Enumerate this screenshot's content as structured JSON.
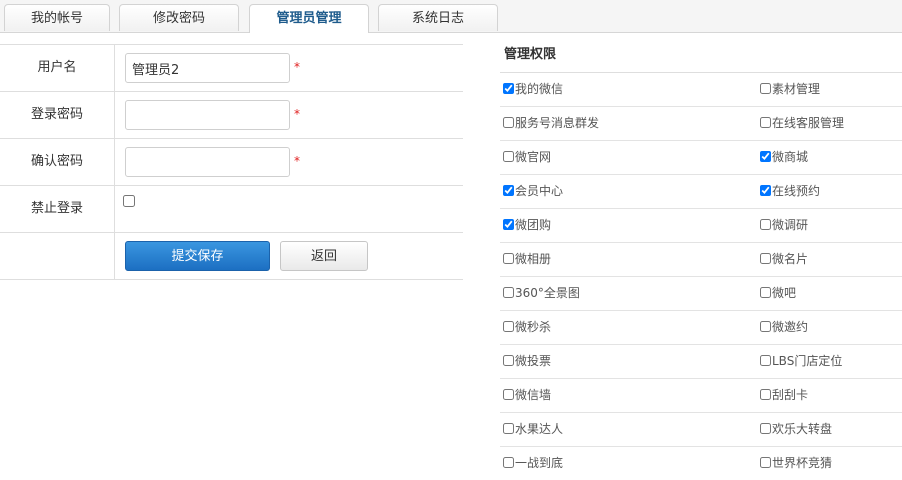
{
  "tabs": [
    {
      "label": "我的帐号",
      "active": false
    },
    {
      "label": "修改密码",
      "active": false
    },
    {
      "label": "管理员管理",
      "active": true
    },
    {
      "label": "系统日志",
      "active": false
    }
  ],
  "form": {
    "username_label": "用户名",
    "username_value": "管理员2",
    "password_label": "登录密码",
    "password_value": "",
    "confirm_label": "确认密码",
    "confirm_value": "",
    "disable_label": "禁止登录",
    "disable_checked": false,
    "required_mark": "*",
    "submit_label": "提交保存",
    "back_label": "返回"
  },
  "permissions": {
    "title": "管理权限",
    "rows": [
      [
        {
          "label": "我的微信",
          "checked": true
        },
        {
          "label": "素材管理",
          "checked": false
        }
      ],
      [
        {
          "label": "服务号消息群发",
          "checked": false
        },
        {
          "label": "在线客服管理",
          "checked": false
        }
      ],
      [
        {
          "label": "微官网",
          "checked": false
        },
        {
          "label": "微商城",
          "checked": true
        }
      ],
      [
        {
          "label": "会员中心",
          "checked": true
        },
        {
          "label": "在线预约",
          "checked": true
        }
      ],
      [
        {
          "label": "微团购",
          "checked": true
        },
        {
          "label": "微调研",
          "checked": false
        }
      ],
      [
        {
          "label": "微相册",
          "checked": false
        },
        {
          "label": "微名片",
          "checked": false
        }
      ],
      [
        {
          "label": "360°全景图",
          "checked": false
        },
        {
          "label": "微吧",
          "checked": false
        }
      ],
      [
        {
          "label": "微秒杀",
          "checked": false
        },
        {
          "label": "微邀约",
          "checked": false
        }
      ],
      [
        {
          "label": "微投票",
          "checked": false
        },
        {
          "label": "LBS门店定位",
          "checked": false
        }
      ],
      [
        {
          "label": "微信墙",
          "checked": false
        },
        {
          "label": "刮刮卡",
          "checked": false
        }
      ],
      [
        {
          "label": "水果达人",
          "checked": false
        },
        {
          "label": "欢乐大转盘",
          "checked": false
        }
      ],
      [
        {
          "label": "一战到底",
          "checked": false
        },
        {
          "label": "世界杯竞猜",
          "checked": false
        }
      ]
    ]
  }
}
